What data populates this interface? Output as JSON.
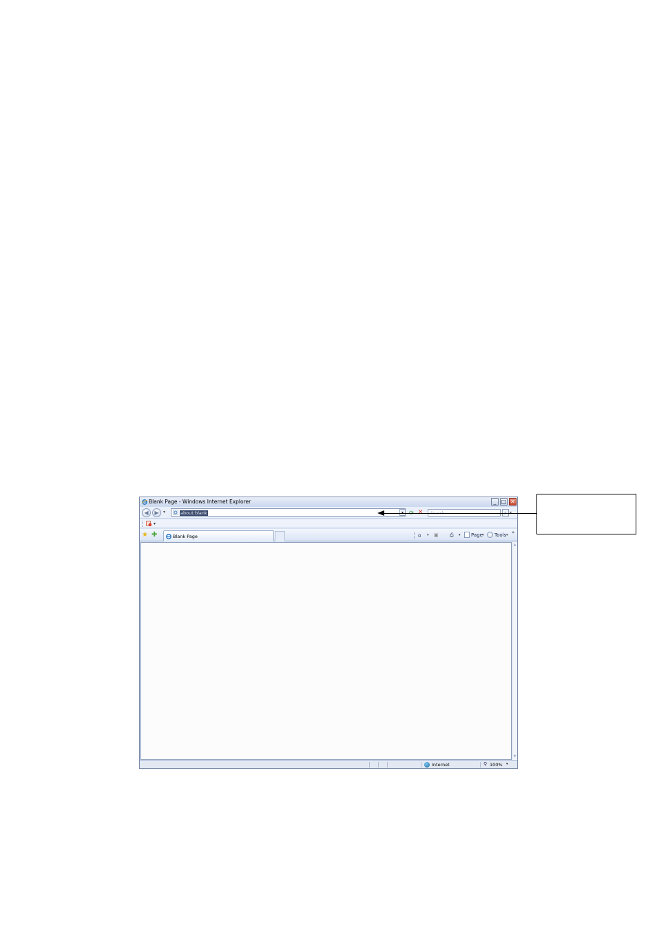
{
  "window": {
    "title": "Blank Page - Windows Internet Explorer",
    "controls": {
      "minimize": "_",
      "maximize": "□",
      "close": "✕"
    }
  },
  "navigation": {
    "back_glyph": "◀",
    "forward_glyph": "▶",
    "recent_pages_glyph": "▾",
    "address_value": "about:blank",
    "address_dropdown_glyph": "▾",
    "refresh_glyph": "⟳",
    "stop_glyph": "✕",
    "search_placeholder": "Search",
    "search_button_glyph": "⌕",
    "search_options_glyph": "▾"
  },
  "links_bar": {
    "addon_dropdown_glyph": "▾"
  },
  "command_bar": {
    "favorites_glyph": "★",
    "add_favorite_glyph": "✚",
    "tab_label": "Blank Page",
    "home_glyph": "⌂",
    "feeds_glyph": "▣",
    "print_glyph": "⎙",
    "page_label": "Page",
    "tools_label": "Tools",
    "dropdown_glyph": "▾",
    "overflow_glyph": "»"
  },
  "status_bar": {
    "zone": "Internet",
    "zoom": "100%",
    "zoom_glyph": "⚲",
    "zoom_dropdown_glyph": "▾"
  },
  "scrollbar": {
    "up_glyph": "▲",
    "down_glyph": "▼"
  },
  "colors": {
    "frame_blue": "#d9e4f5",
    "close_red": "#c8462e",
    "selection_navy": "#3a4a6b",
    "content_white": "#fcfcfc"
  }
}
